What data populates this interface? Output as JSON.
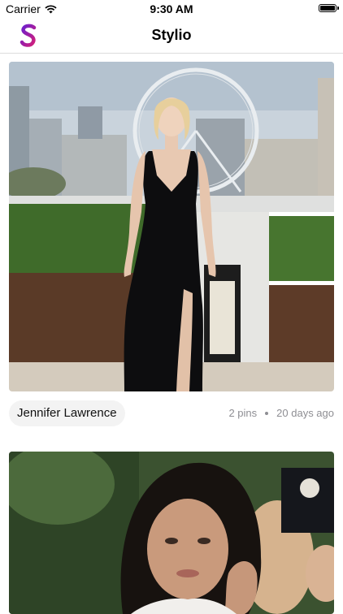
{
  "status_bar": {
    "carrier": "Carrier",
    "time": "9:30 AM",
    "wifi_icon": "wifi-icon",
    "battery_icon": "battery-icon"
  },
  "nav": {
    "title": "Stylio",
    "logo_icon": "stylio-logo",
    "brand_colors": [
      "#6a1fd0",
      "#d21f7a"
    ]
  },
  "feed": {
    "items": [
      {
        "name": "Jennifer Lawrence",
        "pins": "2 pins",
        "age": "20 days ago"
      },
      {
        "name": "",
        "pins": "",
        "age": ""
      }
    ]
  }
}
